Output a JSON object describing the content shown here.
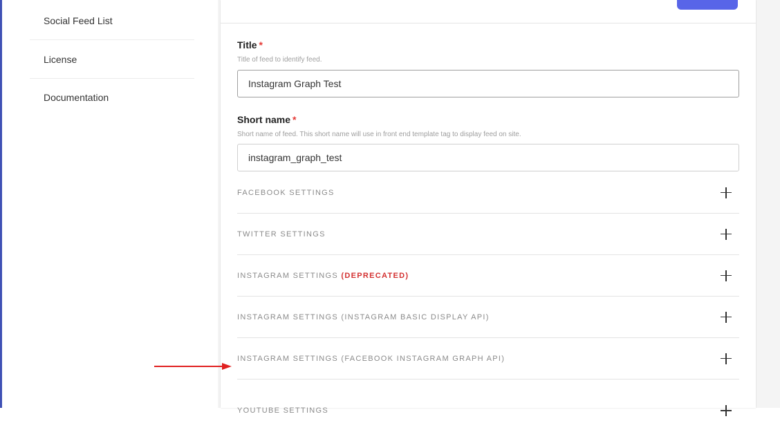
{
  "sidebar": {
    "items": [
      {
        "label": "Social Feed List"
      },
      {
        "label": "License"
      },
      {
        "label": "Documentation"
      }
    ]
  },
  "form": {
    "title": {
      "label": "Title",
      "required_mark": "*",
      "help": "Title of feed to identify feed.",
      "value": "Instagram Graph Test"
    },
    "short_name": {
      "label": "Short name",
      "required_mark": "*",
      "help": "Short name of feed. This short name will use in front end template tag to display feed on site.",
      "value": "instagram_graph_test"
    }
  },
  "sections": [
    {
      "title": "FACEBOOK SETTINGS",
      "icon": "plus-icon"
    },
    {
      "title": "TWITTER SETTINGS",
      "icon": "plus-icon"
    },
    {
      "title": "INSTAGRAM SETTINGS",
      "badge": "(DEPRECATED)",
      "icon": "plus-icon"
    },
    {
      "title": "INSTAGRAM SETTINGS (INSTAGRAM BASIC DISPLAY API)",
      "icon": "plus-icon"
    },
    {
      "title": "INSTAGRAM SETTINGS (FACEBOOK INSTAGRAM GRAPH API)",
      "icon": "plus-icon"
    },
    {
      "title": "YOUTUBE SETTINGS",
      "icon": "plus-icon"
    }
  ],
  "colors": {
    "accent": "#5865e8",
    "required": "#e53935",
    "deprecated": "#d32f2f",
    "arrow": "#e02020"
  }
}
